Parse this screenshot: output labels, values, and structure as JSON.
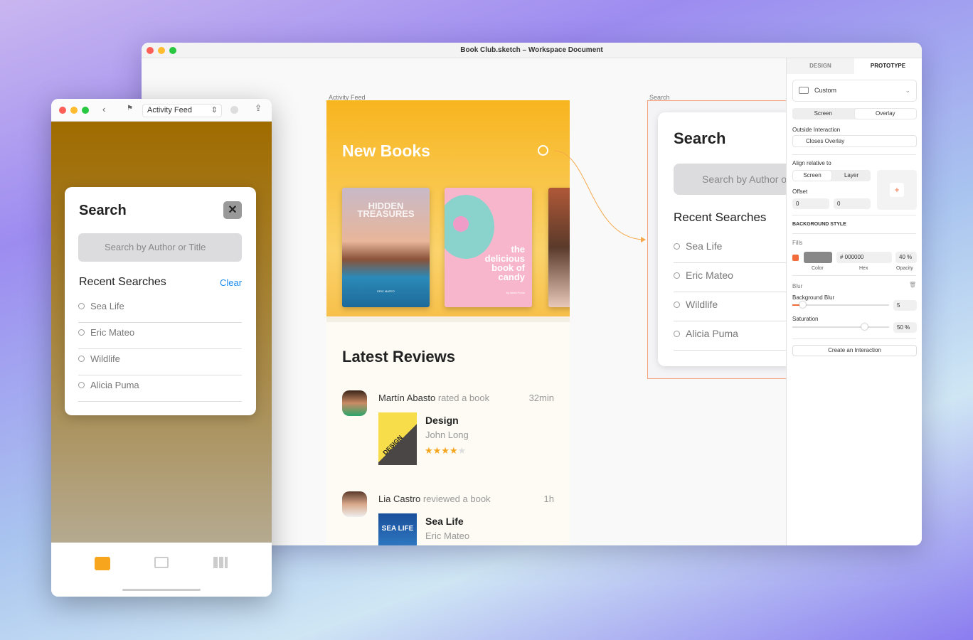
{
  "window": {
    "title": "Book Club.sketch – Workspace Document"
  },
  "canvas": {
    "artboard1_label": "Activity Feed",
    "artboard2_label": "Search"
  },
  "feed": {
    "header_title": "New Books",
    "books": [
      {
        "title": "HIDDEN TREASURES",
        "author": "ERIC MATEO"
      },
      {
        "title": "the delicious book of candy",
        "author": "by Alicia Puma"
      }
    ],
    "reviews_title": "Latest Reviews",
    "reviews": [
      {
        "user": "Martín Abasto",
        "action": "rated a book",
        "time": "32min",
        "book": "Design",
        "author": "John Long",
        "cover": "DESIGN",
        "rating": 4,
        "max": 5
      },
      {
        "user": "Lia Castro",
        "action": "reviewed a book",
        "time": "1h",
        "book": "Sea Life",
        "author": "Eric Mateo",
        "cover": "SEA LIFE"
      }
    ]
  },
  "search": {
    "title": "Search",
    "placeholder": "Search by Author or Title",
    "recent_title": "Recent Searches",
    "clear": "Clear",
    "items": [
      "Sea Life",
      "Eric Mateo",
      "Wildlife",
      "Alicia Puma"
    ]
  },
  "inspector": {
    "tabs": [
      "DESIGN",
      "PROTOTYPE"
    ],
    "active_tab": "PROTOTYPE",
    "device": "Custom",
    "mode": [
      "Screen",
      "Overlay"
    ],
    "mode_selected": "Overlay",
    "outside_label": "Outside Interaction",
    "outside_value": "Closes Overlay",
    "align_label": "Align relative to",
    "align": [
      "Screen",
      "Layer"
    ],
    "align_selected": "Screen",
    "offset_label": "Offset",
    "offset_x": "0",
    "offset_y": "0",
    "bg_style": "BACKGROUND STYLE",
    "fills": "Fills",
    "hex": "# 000000",
    "opacity": "40",
    "pct": "%",
    "color_lbl": "Color",
    "hex_lbl": "Hex",
    "opacity_lbl": "Opacity",
    "blur": "Blur",
    "bg_blur": "Background Blur",
    "bg_blur_value": "5",
    "saturation": "Saturation",
    "saturation_value": "50",
    "create": "Create an Interaction",
    "accent": "#f26b3a"
  },
  "preview": {
    "page_select": "Activity Feed"
  }
}
